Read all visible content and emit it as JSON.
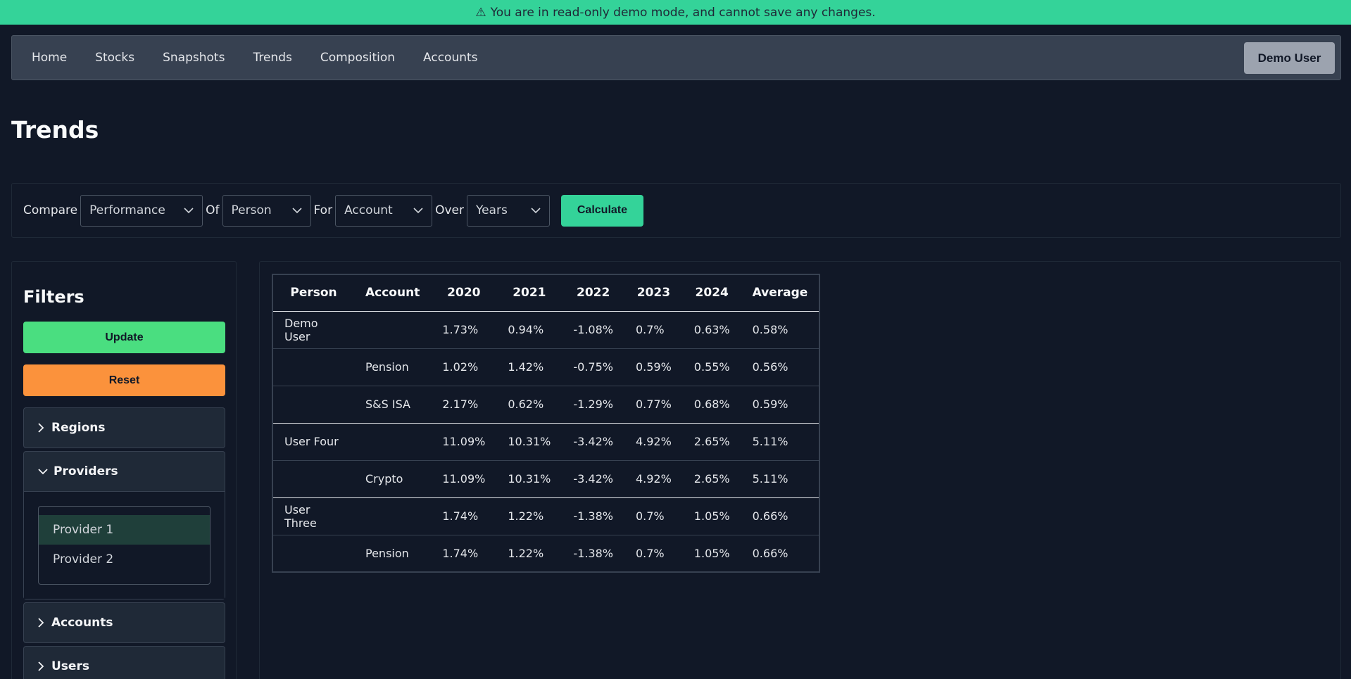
{
  "banner": {
    "icon": "warning-icon",
    "text": "You are in read-only demo mode, and cannot save any changes."
  },
  "nav": {
    "links": [
      "Home",
      "Stocks",
      "Snapshots",
      "Trends",
      "Composition",
      "Accounts"
    ],
    "user_label": "Demo User"
  },
  "page": {
    "title": "Trends"
  },
  "compare": {
    "compare_label": "Compare",
    "compare_value": "Performance",
    "of_label": "Of",
    "of_value": "Person",
    "for_label": "For",
    "for_value": "Account",
    "over_label": "Over",
    "over_value": "Years",
    "calculate_label": "Calculate"
  },
  "filters": {
    "title": "Filters",
    "update_label": "Update",
    "reset_label": "Reset",
    "sections": [
      {
        "label": "Regions",
        "expanded": false
      },
      {
        "label": "Providers",
        "expanded": true,
        "items": [
          "Provider 1",
          "Provider 2"
        ],
        "selected": "Provider 1"
      },
      {
        "label": "Accounts",
        "expanded": false
      },
      {
        "label": "Users",
        "expanded": false
      }
    ]
  },
  "table": {
    "headers": [
      "Person",
      "Account",
      "2020",
      "2021",
      "2022",
      "2023",
      "2024",
      "Average"
    ],
    "rows": [
      [
        "Demo User",
        "",
        "1.73%",
        "0.94%",
        "-1.08%",
        "0.7%",
        "0.63%",
        "0.58%"
      ],
      [
        "",
        "Pension",
        "1.02%",
        "1.42%",
        "-0.75%",
        "0.59%",
        "0.55%",
        "0.56%"
      ],
      [
        "",
        "S&S ISA",
        "2.17%",
        "0.62%",
        "-1.29%",
        "0.77%",
        "0.68%",
        "0.59%"
      ],
      [
        "User Four",
        "",
        "11.09%",
        "10.31%",
        "-3.42%",
        "4.92%",
        "2.65%",
        "5.11%"
      ],
      [
        "",
        "Crypto",
        "11.09%",
        "10.31%",
        "-3.42%",
        "4.92%",
        "2.65%",
        "5.11%"
      ],
      [
        "User Three",
        "",
        "1.74%",
        "1.22%",
        "-1.38%",
        "0.7%",
        "1.05%",
        "0.66%"
      ],
      [
        "",
        "Pension",
        "1.74%",
        "1.22%",
        "-1.38%",
        "0.7%",
        "1.05%",
        "0.66%"
      ]
    ]
  },
  "colors": {
    "accent": "#34d399",
    "update": "#4ade80",
    "reset": "#fb923c",
    "background": "#111827"
  }
}
